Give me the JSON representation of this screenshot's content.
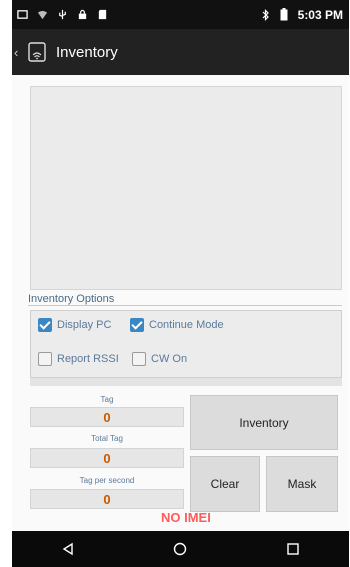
{
  "status_bar": {
    "time": "5:03 PM"
  },
  "action_bar": {
    "title": "Inventory"
  },
  "inventory_options": {
    "title": "Inventory Options",
    "checkboxes": [
      {
        "label": "Display PC",
        "checked": true
      },
      {
        "label": "Continue Mode",
        "checked": true
      },
      {
        "label": "Report RSSI",
        "checked": false
      },
      {
        "label": "CW On",
        "checked": false
      }
    ]
  },
  "counters": {
    "tag": {
      "label": "Tag",
      "value": "0"
    },
    "total_tag": {
      "label": "Total Tag",
      "value": "0"
    },
    "tag_per_second": {
      "label": "Tag per second",
      "value": "0"
    }
  },
  "buttons": {
    "inventory": "Inventory",
    "clear": "Clear",
    "mask": "Mask"
  },
  "warning": "NO IMEI",
  "colors": {
    "accent": "#3a87c6",
    "counter_value": "#c85a00",
    "warning": "#ff5c5c"
  }
}
